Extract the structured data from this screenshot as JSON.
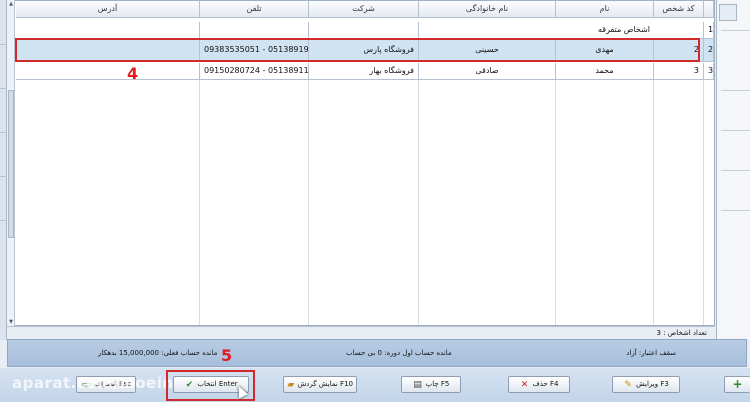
{
  "grid": {
    "columns": [
      "کد شخص",
      "نام",
      "نام خانوادگی",
      "شرکت",
      "تلفن",
      "آدرس"
    ],
    "rows": [
      {
        "index": "1",
        "code": "",
        "name": "اشخاص متفرقه",
        "family": "",
        "company": "",
        "phone": "",
        "address": ""
      },
      {
        "index": "2",
        "code": "2",
        "name": "مهدی",
        "family": "حسینی",
        "company": "فروشگاه پارس",
        "phone": "09383535051 - 05138919999",
        "address": ""
      },
      {
        "index": "3",
        "code": "3",
        "name": "محمد",
        "family": "صادقی",
        "company": "فروشگاه بهار",
        "phone": "09150280724 - 05138911801",
        "address": ""
      }
    ]
  },
  "annotations": {
    "step4": "4",
    "step5": "5"
  },
  "count_bar": {
    "text": "تعداد اشخاص : 3"
  },
  "info_bar": {
    "credit_limit": "سقف اعتبار: آزاد",
    "opening_balance": "مانده حساب اول دوره: 0 بی حساب",
    "current_balance": "مانده حساب فعلی: 15,000,000 بدهکار"
  },
  "buttons": {
    "cancel": "انصراف Esc",
    "ok": "انتخاب Enter",
    "show_turnover": "نمایش گردش F10",
    "print": "چاپ F5",
    "delete": "حذف F4",
    "edit": "ویرایش F3",
    "add": "+"
  },
  "watermark": "aparat.com/moein",
  "icons": {
    "cancel": "money-icon",
    "ok": "checkmark-icon",
    "show_turnover": "folder-icon",
    "print": "printer-icon",
    "delete": "delete-x-icon",
    "edit": "pencil-icon"
  },
  "colors": {
    "accent_red": "#d22a2a",
    "selected_row": "#cfe3f3"
  }
}
